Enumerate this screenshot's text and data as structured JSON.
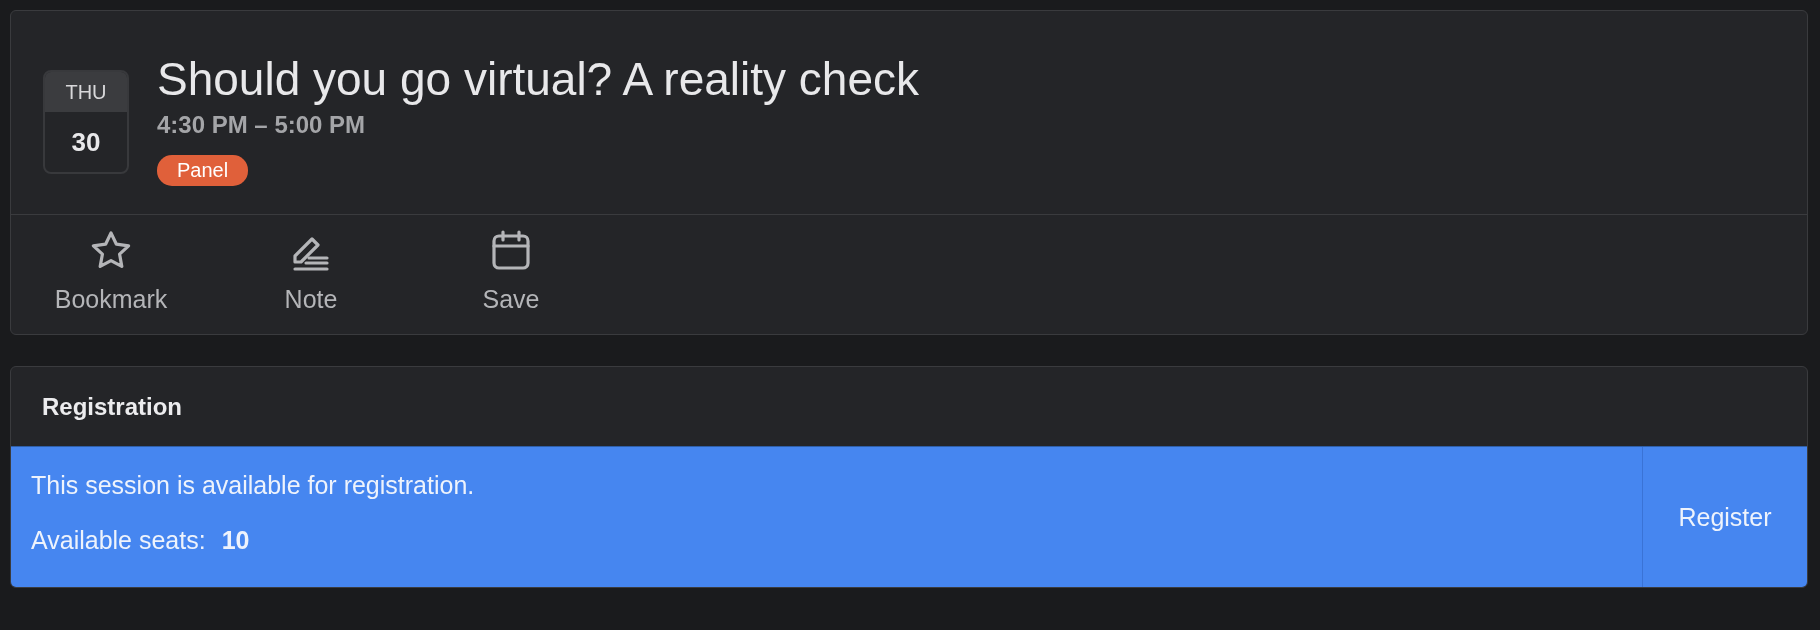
{
  "session": {
    "date": {
      "weekday": "THU",
      "day": "30"
    },
    "title": "Should you go virtual? A reality check",
    "time": "4:30 PM – 5:00 PM",
    "tag": {
      "label": "Panel",
      "color": "#e0603a"
    }
  },
  "actions": [
    {
      "kind": "star",
      "label": "Bookmark"
    },
    {
      "kind": "note",
      "label": "Note"
    },
    {
      "kind": "calendar",
      "label": "Save"
    }
  ],
  "registration": {
    "heading": "Registration",
    "message": "This session is available for registration.",
    "seats_label": "Available seats:",
    "seats": "10",
    "button": "Register"
  }
}
